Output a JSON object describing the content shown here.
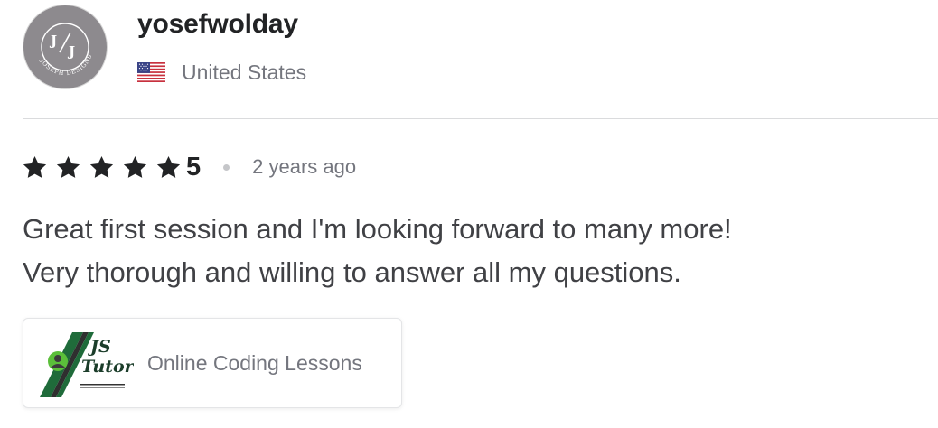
{
  "reviewer": {
    "username": "yosefwolday",
    "country": "United States",
    "flag_icon": "us-flag-icon",
    "avatar": {
      "monogram": "J/J",
      "ring_text": "JOSEPH DESIGNS",
      "background": "#8d8a8e"
    }
  },
  "rating": {
    "stars": 5,
    "value": "5",
    "time_ago": "2 years ago",
    "star_color": "#222325"
  },
  "review": {
    "text": "Great first session and I'm looking forward to many more!\nVery thorough and willing to answer all my questions."
  },
  "gig": {
    "title": "Online Coding Lessons",
    "thumbnail": {
      "logo_line1": "JS",
      "logo_line2": "Tutor",
      "accent": "#1f6b3a"
    }
  },
  "colors": {
    "primary_text": "#222325",
    "secondary_text": "#74767e",
    "body_text": "#404145",
    "divider": "#dadbdd"
  }
}
